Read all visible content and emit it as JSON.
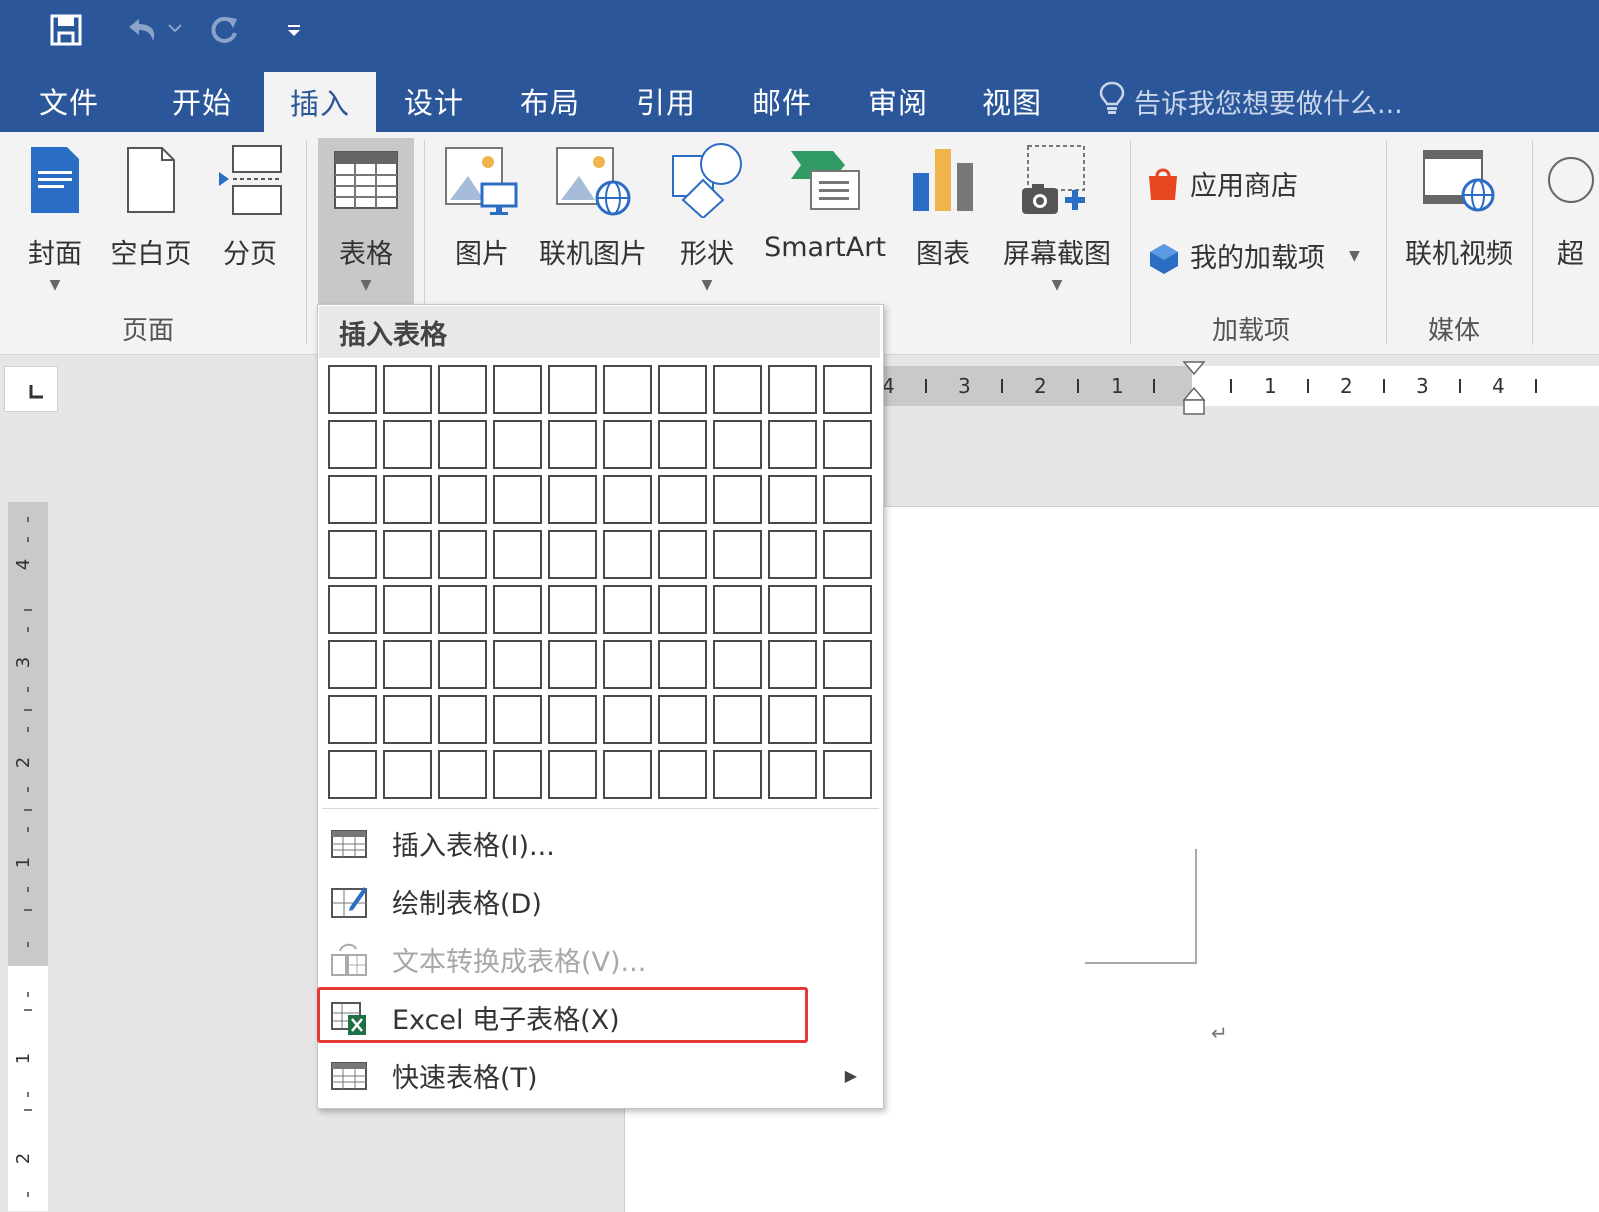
{
  "quick_access": {
    "save_icon": "save-icon",
    "undo_icon": "undo-icon",
    "redo_icon": "redo-icon",
    "customize_icon": "customize-icon"
  },
  "tabs": [
    {
      "label": "文件"
    },
    {
      "label": "开始"
    },
    {
      "label": "插入"
    },
    {
      "label": "设计"
    },
    {
      "label": "布局"
    },
    {
      "label": "引用"
    },
    {
      "label": "邮件"
    },
    {
      "label": "审阅"
    },
    {
      "label": "视图"
    }
  ],
  "tell_me": "告诉我您想要做什么...",
  "ribbon": {
    "pages": {
      "cover": "封面",
      "blank": "空白页",
      "break": "分页",
      "group": "页面"
    },
    "table": "表格",
    "illustrations": {
      "picture": "图片",
      "online_picture": "联机图片",
      "shapes": "形状",
      "smartart": "SmartArt",
      "chart": "图表",
      "screenshot": "屏幕截图"
    },
    "addins": {
      "store": "应用商店",
      "my_addins": "我的加载项",
      "group": "加载项"
    },
    "media": {
      "online_video": "联机视频",
      "group": "媒体"
    },
    "cut_off": "超"
  },
  "colors": {
    "brand": "#2b579a",
    "highlight": "#e53935"
  },
  "ruler": {
    "h_numbers": [
      "4",
      "3",
      "2",
      "1",
      "1",
      "2",
      "3",
      "4"
    ],
    "v_numbers": [
      "4",
      "3",
      "2",
      "1",
      "1",
      "2"
    ]
  },
  "dropdown": {
    "title": "插入表格",
    "rows": 8,
    "cols": 10,
    "items": [
      {
        "label": "插入表格(I)...",
        "icon": "table-icon",
        "disabled": false
      },
      {
        "label": "绘制表格(D)",
        "icon": "draw-table-icon",
        "disabled": false
      },
      {
        "label": "文本转换成表格(V)...",
        "icon": "convert-text-icon",
        "disabled": true
      },
      {
        "label": "Excel 电子表格(X)",
        "icon": "excel-icon",
        "disabled": false
      },
      {
        "label": "快速表格(T)",
        "icon": "quick-table-icon",
        "disabled": false
      }
    ]
  },
  "page": {
    "return_mark": "↵"
  }
}
